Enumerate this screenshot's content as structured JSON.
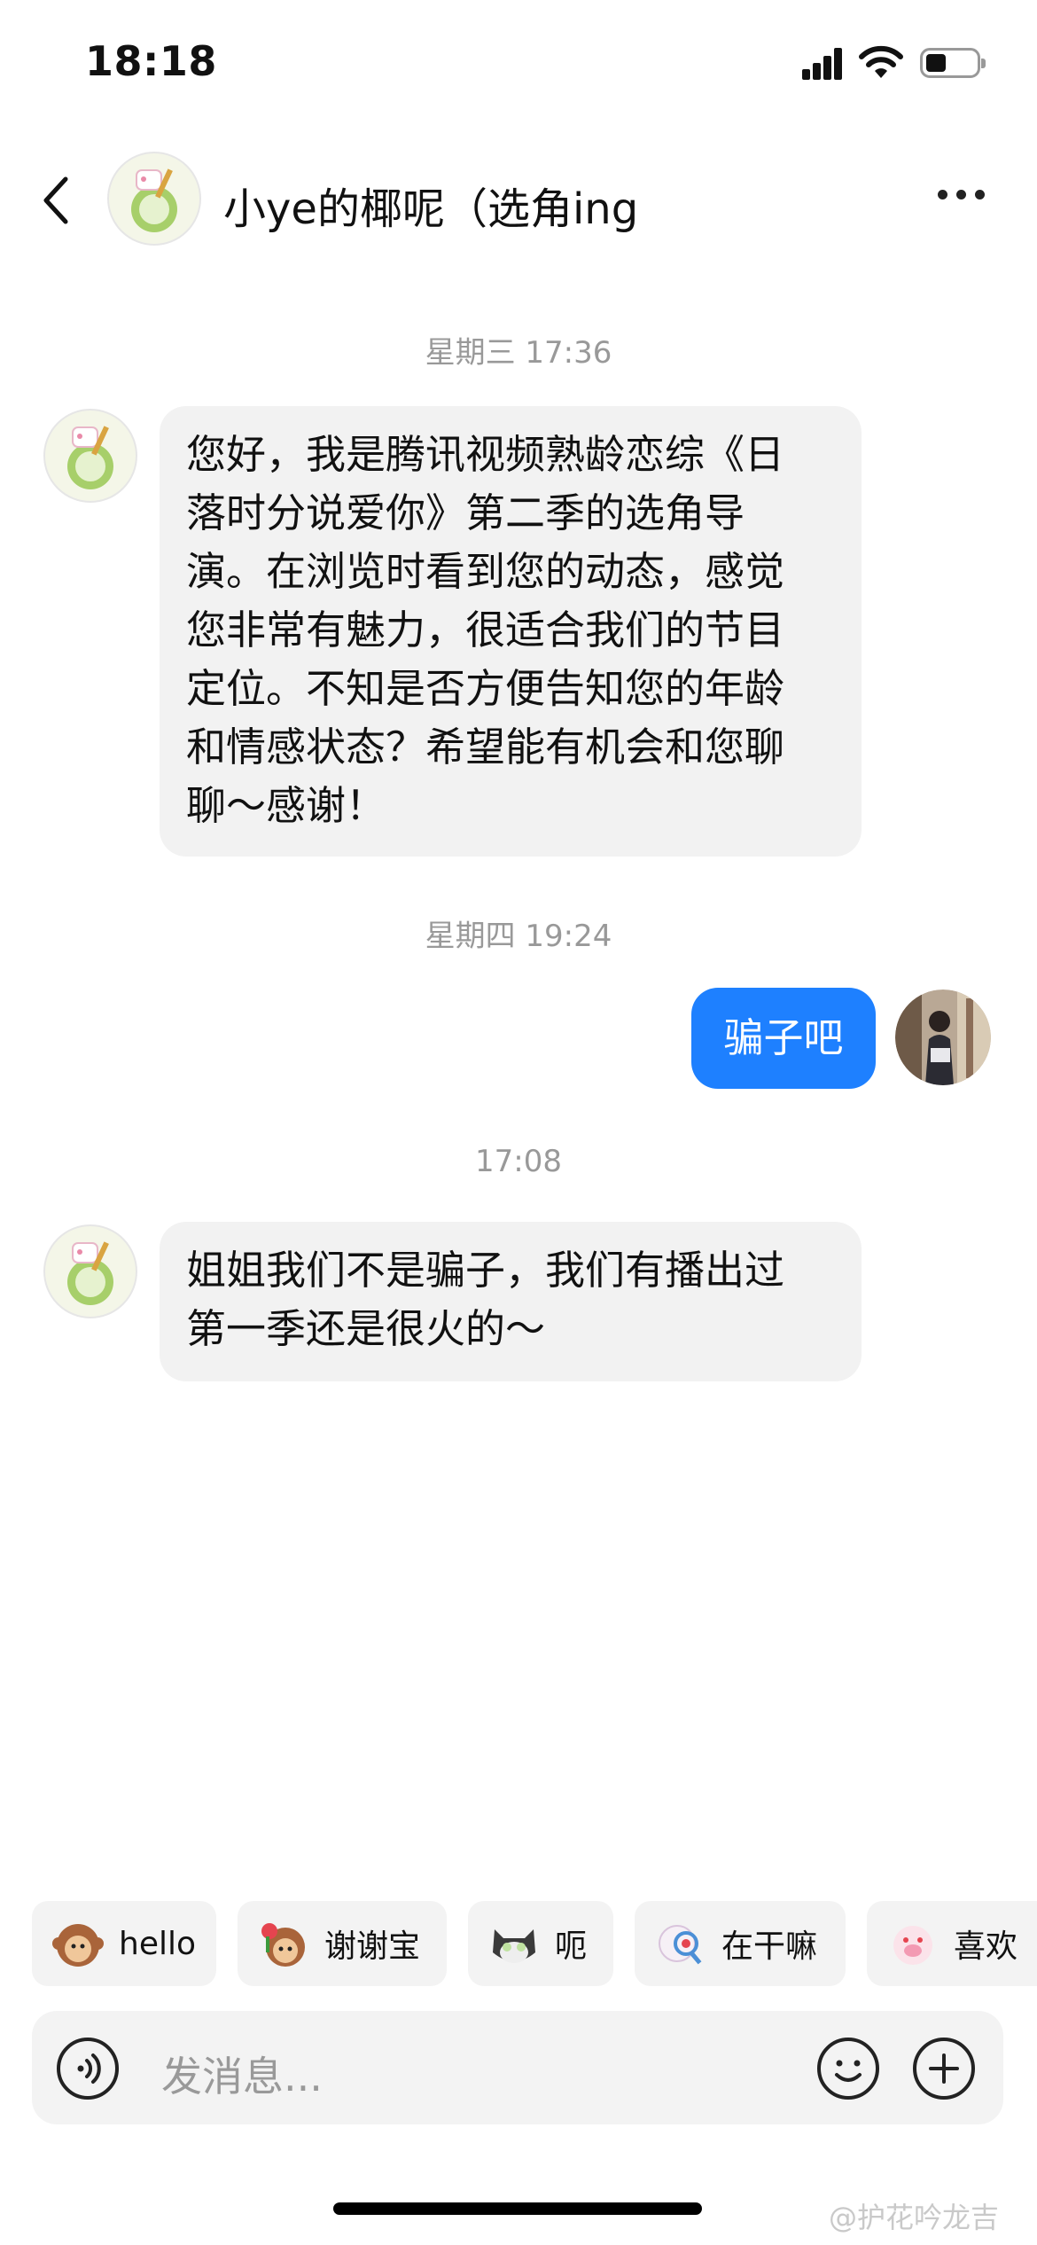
{
  "status_bar": {
    "time": "18:18"
  },
  "header": {
    "title": "小ye的椰呢（选角ing"
  },
  "messages": {
    "ts1": "星期三 17:36",
    "msg1": [
      "您好，我是腾讯视频熟龄恋综《日",
      "落时分说爱你》第二季的选角导",
      "演。在浏览时看到您的动态，感觉",
      "您非常有魅力，很适合我们的节目",
      "定位。不知是否方便告知您的年龄",
      "和情感状态？希望能有机会和您聊",
      "聊～感谢！"
    ],
    "ts2": "星期四 19:24",
    "msg2": "骗子吧",
    "ts3": "17:08",
    "msg3": [
      "姐姐我们不是骗子，我们有播出过",
      "第一季还是很火的～"
    ]
  },
  "quick_replies": [
    {
      "label": "hello",
      "icon": "monkey-wave-icon"
    },
    {
      "label": "谢谢宝",
      "icon": "monkey-flower-icon"
    },
    {
      "label": "呃",
      "icon": "cat-icon"
    },
    {
      "label": "在干嘛",
      "icon": "magnifier-creature-icon"
    },
    {
      "label": "喜欢",
      "icon": "pig-icon"
    }
  ],
  "input": {
    "placeholder": "发消息..."
  },
  "watermark": "@护花吟龙吉",
  "colors": {
    "self_bubble": "#1e80ff",
    "other_bubble": "#f2f2f2",
    "timestamp": "#999999"
  }
}
